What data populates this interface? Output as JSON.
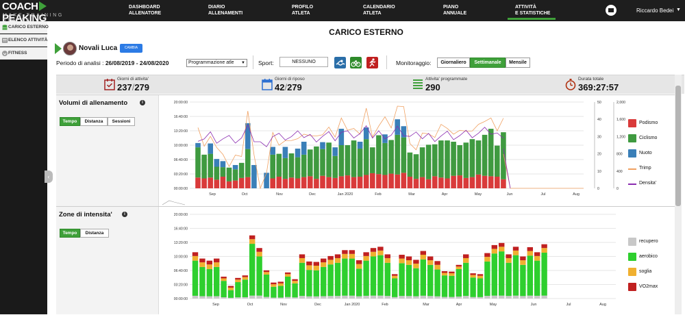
{
  "brand": {
    "line1a": "COACH",
    "line1b": "PEAKING",
    "line2": "MAKE TRAINING SIMPLE",
    "accent": "#3fa03a"
  },
  "nav": [
    {
      "label": "DASHBOARD\nALLENATORE"
    },
    {
      "label": "DIARIO\nALLENAMENTI"
    },
    {
      "label": "PROFILO\nATLETA"
    },
    {
      "label": "CALENDARIO\nATLETA"
    },
    {
      "label": "PIANO\nANNUALE"
    },
    {
      "label": "ATTIVITÀ\nE STATISTICHE",
      "active": true
    }
  ],
  "user": {
    "name": "Riccardo Bedei",
    "caret": "▼"
  },
  "sidebar": [
    {
      "label": "CARICO ESTERNO",
      "icon": "database-icon"
    },
    {
      "label": "ELENCO ATTIVITÀ",
      "icon": "list-icon"
    },
    {
      "label": "FITNESS",
      "icon": "heart-icon"
    }
  ],
  "page": {
    "title": "CARICO ESTERNO",
    "athlete": "Novali Luca",
    "change_btn": "CAMBIA",
    "period_label": "Periodo di analisi : ",
    "period_value": "26/08/2019 - 24/08/2020",
    "programming_select": "Programmazione atle",
    "sport_label": "Sport:",
    "sport_value": "NESSUNO",
    "monitor_label": "Monitoraggio:",
    "monitor_options": [
      "Giornaliero",
      "Settimanale",
      "Mensile"
    ],
    "monitor_selected": "Settimanale"
  },
  "stats": [
    {
      "label": "Giorni di attivita'",
      "value": "237",
      "total": "279",
      "icon": "calendar-check-icon",
      "color": "#a02020"
    },
    {
      "label": "Giorni di riposo",
      "value": "42",
      "total": "279",
      "icon": "calendar-icon",
      "color": "#2c6fd1"
    },
    {
      "label": "Attivita' programmate",
      "value": "290",
      "total": "",
      "icon": "list-lines-icon",
      "color": "#3fa03a"
    },
    {
      "label": "Durata totale",
      "value": "369:27:57",
      "total": "",
      "icon": "stopwatch-icon",
      "color": "#b03010"
    }
  ],
  "panel1": {
    "title": "Volumi di allenamento",
    "toggles": [
      "Tempo",
      "Distanza",
      "Sessioni"
    ],
    "selected": "Tempo"
  },
  "panel2": {
    "title": "Zone di intensita'",
    "toggles": [
      "Tempo",
      "Distanza"
    ],
    "selected": "Tempo"
  },
  "chart_data": [
    {
      "type": "bar",
      "stacked": true,
      "y_ticks": [
        "00:00:00",
        "03:20:00",
        "06:40:00",
        "10:00:00",
        "13:20:00",
        "16:40:00",
        "20:00:00"
      ],
      "ylim_hours": [
        0,
        20
      ],
      "y2_ticks": [
        "0",
        "10",
        "20",
        "30",
        "40",
        "50"
      ],
      "y3_ticks": [
        "0",
        "400",
        "800",
        "1,200",
        "1,600",
        "2,000"
      ],
      "months": [
        "Sep",
        "Oct",
        "Nov",
        "Dec",
        "Jan 2020",
        "Feb",
        "Mar",
        "Apr",
        "May",
        "Jun",
        "Jul",
        "Aug"
      ],
      "series": [
        {
          "name": "Podismo",
          "color": "#d93a3a",
          "values": [
            2.5,
            2.3,
            2.5,
            2.0,
            2.7,
            1.6,
            1.8,
            2.4,
            2.6,
            0,
            0,
            0,
            2.3,
            2.7,
            2.2,
            2.5,
            2.3,
            2.6,
            2.8,
            2.2,
            2.9,
            2.6,
            2.4,
            2.8,
            3.0,
            2.6,
            2.7,
            3.1,
            3.5,
            3.3,
            3.1,
            3.4,
            3.2,
            3.6,
            2.7,
            2.2,
            2.6,
            2.1,
            2.8,
            2.5,
            2.3,
            2.9,
            3.0,
            2.4,
            2.6,
            3.2,
            2.9,
            2.8,
            2.7,
            2.1,
            0
          ]
        },
        {
          "name": "Ciclismo",
          "color": "#3f9a40",
          "values": [
            7.0,
            5.5,
            5.5,
            3.0,
            2.2,
            3.2,
            2.6,
            3.5,
            6.5,
            0,
            0,
            0,
            5.5,
            5.3,
            4.8,
            5.6,
            4.9,
            5.2,
            6.2,
            7.5,
            6.2,
            8.0,
            5.1,
            7.2,
            7.0,
            8.5,
            6.5,
            8.3,
            6.0,
            9.0,
            7.4,
            7.8,
            9.2,
            8.2,
            5.6,
            5.7,
            6.9,
            8.0,
            7.4,
            8.6,
            8.8,
            7.9,
            7.0,
            8.2,
            8.8,
            7.9,
            9.5,
            11.0,
            7.2,
            10.9,
            0
          ]
        },
        {
          "name": "Nuoto",
          "color": "#3a7fb8",
          "values": [
            1.0,
            0.0,
            2.4,
            1.8,
            1.4,
            0,
            1.0,
            0,
            6.0,
            5.4,
            0,
            3.6,
            1.8,
            0,
            2.6,
            0,
            2.0,
            3.0,
            0,
            0,
            1.6,
            0,
            2.0,
            3.8,
            0,
            0,
            1.6,
            2.7,
            0,
            0,
            2.0,
            0,
            3.6,
            2.6,
            0,
            0,
            0,
            0,
            0,
            0,
            0,
            0,
            0,
            0,
            0,
            0,
            0,
            0,
            0,
            0,
            0
          ]
        }
      ],
      "lines": [
        {
          "name": "Trimp",
          "color": "#f0a060"
        },
        {
          "name": "Densita'",
          "color": "#8a2bb0"
        }
      ]
    },
    {
      "type": "bar",
      "stacked": true,
      "y_ticks": [
        "00:00:00",
        "03:20:00",
        "06:40:00",
        "10:00:00",
        "13:20:00",
        "16:40:00",
        "20:00:00"
      ],
      "ylim_hours": [
        0,
        20
      ],
      "months": [
        "Sep",
        "Oct",
        "Nov",
        "Dec",
        "Jan 2020",
        "Feb",
        "Mar",
        "Apr",
        "May",
        "Jun",
        "Jul",
        "Aug"
      ],
      "series": [
        {
          "name": "recupero",
          "color": "#c8c8c8"
        },
        {
          "name": "aerobico",
          "color": "#2ecf2e"
        },
        {
          "name": "soglia",
          "color": "#f0b030"
        },
        {
          "name": "VO2max",
          "color": "#c02020"
        }
      ],
      "totals": [
        11.0,
        9.5,
        9.0,
        9.5,
        5.2,
        3.0,
        4.9,
        5.5,
        15.0,
        12.0,
        6.7,
        3.8,
        4.0,
        6.2,
        4.6,
        10.5,
        8.8,
        8.7,
        9.5,
        10.1,
        10.5,
        11.5,
        11.5,
        9.1,
        11.0,
        12.0,
        12.3,
        10.5,
        5.8,
        10.4,
        10.0,
        9.2,
        11.3,
        10.0,
        8.9,
        6.5,
        6.4,
        8.0,
        10.5,
        6.0,
        5.8,
        10.8,
        12.7,
        13.2,
        10.5,
        12.3,
        10.0,
        12.2,
        11.0,
        12.9,
        0
      ]
    }
  ]
}
